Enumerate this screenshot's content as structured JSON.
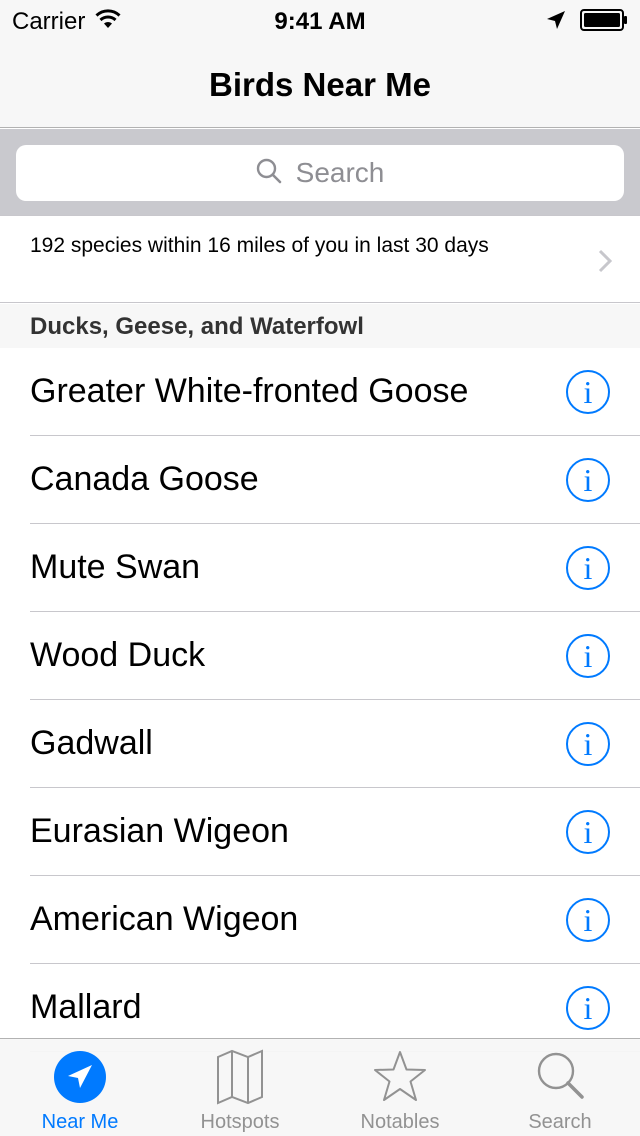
{
  "status": {
    "carrier": "Carrier",
    "time": "9:41 AM",
    "wifi_icon": "wifi-icon",
    "location_icon": "location-arrow-icon",
    "battery_icon": "battery-full-icon"
  },
  "nav": {
    "title": "Birds Near Me"
  },
  "search": {
    "placeholder": "Search",
    "icon": "search-icon"
  },
  "summary": {
    "text": "192 species within 16 miles of you in last 30 days",
    "chevron": "chevron-right-icon"
  },
  "section": {
    "title": "Ducks, Geese, and Waterfowl"
  },
  "birds": [
    {
      "name": "Greater White-fronted Goose"
    },
    {
      "name": "Canada Goose"
    },
    {
      "name": "Mute Swan"
    },
    {
      "name": "Wood Duck"
    },
    {
      "name": "Gadwall"
    },
    {
      "name": "Eurasian Wigeon"
    },
    {
      "name": "American Wigeon"
    },
    {
      "name": "Mallard"
    }
  ],
  "info_glyph": "i",
  "tabs": [
    {
      "label": "Near Me",
      "icon": "location-icon",
      "active": true
    },
    {
      "label": "Hotspots",
      "icon": "map-icon",
      "active": false
    },
    {
      "label": "Notables",
      "icon": "star-icon",
      "active": false
    },
    {
      "label": "Search",
      "icon": "search-icon",
      "active": false
    }
  ],
  "colors": {
    "accent": "#007aff",
    "bar": "#f7f7f7",
    "search_bg": "#c9c9ce",
    "inactive": "#929292"
  }
}
